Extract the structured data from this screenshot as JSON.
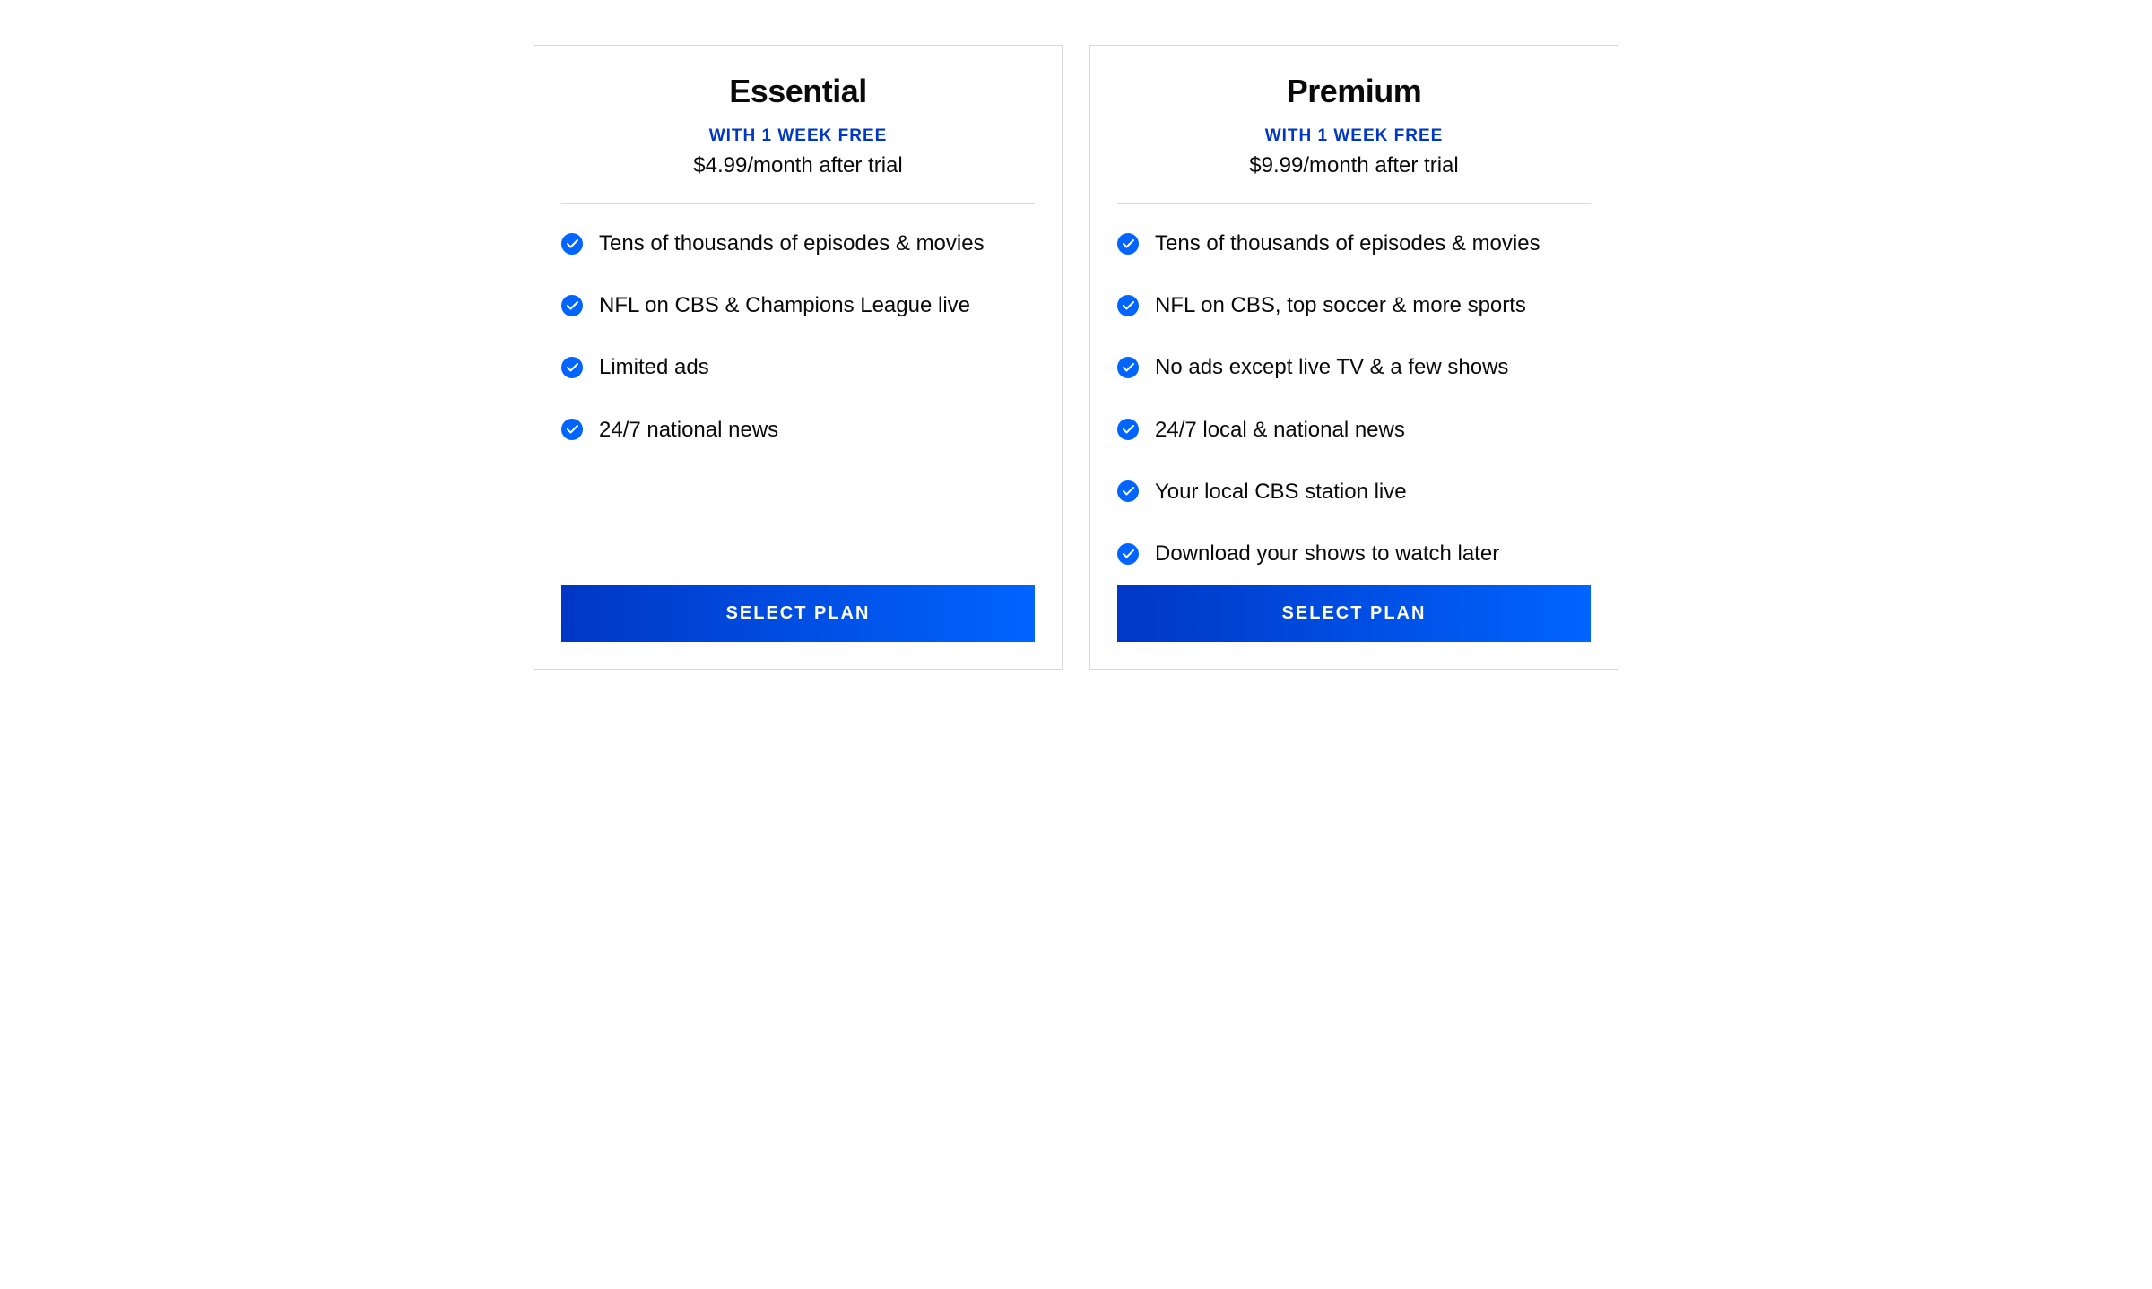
{
  "plans": [
    {
      "id": "essential",
      "title": "Essential",
      "trial_label": "WITH 1 WEEK FREE",
      "price_label": "$4.99/month after trial",
      "features": [
        "Tens of thousands of episodes & movies",
        "NFL on CBS & Champions League live",
        "Limited ads",
        "24/7 national news"
      ],
      "button_label": "SELECT PLAN"
    },
    {
      "id": "premium",
      "title": "Premium",
      "trial_label": "WITH 1 WEEK FREE",
      "price_label": "$9.99/month after trial",
      "features": [
        "Tens of thousands of episodes & movies",
        "NFL on CBS, top soccer & more sports",
        "No ads except live TV & a few shows",
        "24/7 local & national news",
        "Your local CBS station live",
        "Download your shows to watch later"
      ],
      "button_label": "SELECT PLAN"
    }
  ],
  "colors": {
    "accent": "#0064ff",
    "accent_dark": "#0037c5",
    "text": "#0a0a0a",
    "border": "#d8d8d8"
  }
}
